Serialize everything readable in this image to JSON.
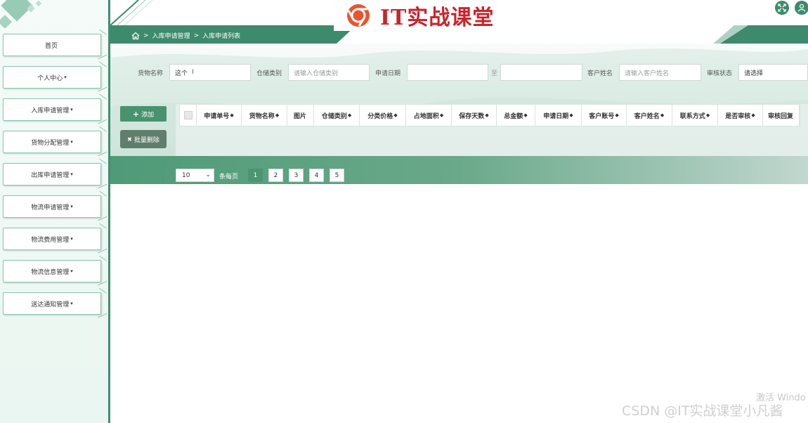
{
  "brand": {
    "text": "IT实战课堂"
  },
  "breadcrumb": {
    "sep": ">",
    "items": [
      "入库申请管理",
      "入库申请列表"
    ]
  },
  "sidebar": {
    "items": [
      {
        "label": "首页",
        "caret": ""
      },
      {
        "label": "个人中心",
        "caret": "▾"
      },
      {
        "label": "入库申请管理",
        "caret": "▾"
      },
      {
        "label": "货物分配管理",
        "caret": "▾"
      },
      {
        "label": "出库申请管理",
        "caret": "▾"
      },
      {
        "label": "物流申请管理",
        "caret": "▾"
      },
      {
        "label": "物流费用管理",
        "caret": "▾"
      },
      {
        "label": "物流信息管理",
        "caret": "▾"
      },
      {
        "label": "送达通知管理",
        "caret": "▾"
      }
    ]
  },
  "search": {
    "goods_name": {
      "label": "货物名称",
      "value": "这个"
    },
    "storage_type": {
      "label": "仓储类别",
      "placeholder": "请输入仓储类别"
    },
    "apply_date": {
      "label": "申请日期",
      "to": "至"
    },
    "customer_name": {
      "label": "客户姓名",
      "placeholder": "请输入客户姓名"
    },
    "review_status": {
      "label": "审核状态",
      "placeholder": "请选择"
    }
  },
  "toolbar": {
    "add_label": "添加",
    "batch_delete_label": "批量删除",
    "add_icon": "+",
    "delete_icon": "✖"
  },
  "table": {
    "columns": [
      {
        "label": "申请单号",
        "sort": "◆"
      },
      {
        "label": "货物名称",
        "sort": "◆"
      },
      {
        "label": "图片",
        "sort": ""
      },
      {
        "label": "仓储类别",
        "sort": "◆"
      },
      {
        "label": "分类价格",
        "sort": "◆"
      },
      {
        "label": "占地面积",
        "sort": "◆"
      },
      {
        "label": "保存天数",
        "sort": "◆"
      },
      {
        "label": "总金额",
        "sort": "◆"
      },
      {
        "label": "申请日期",
        "sort": "◆"
      },
      {
        "label": "客户账号",
        "sort": "◆"
      },
      {
        "label": "客户姓名",
        "sort": "◆"
      },
      {
        "label": "联系方式",
        "sort": "◆"
      },
      {
        "label": "是否审核",
        "sort": "◆"
      },
      {
        "label": "审核回复",
        "sort": ""
      }
    ],
    "rows": []
  },
  "pagination": {
    "page_size": "10",
    "per_page_label": "条每页",
    "pages": [
      "1",
      "2",
      "3",
      "4",
      "5"
    ],
    "current": "1"
  },
  "watermarks": {
    "windows": "激活 Windo",
    "csdn": "CSDN @IT实战课堂小凡酱"
  },
  "colors": {
    "accent": "#3d8a6c",
    "brand_red": "#c8262c",
    "sidebar_border": "#3f8f72"
  }
}
